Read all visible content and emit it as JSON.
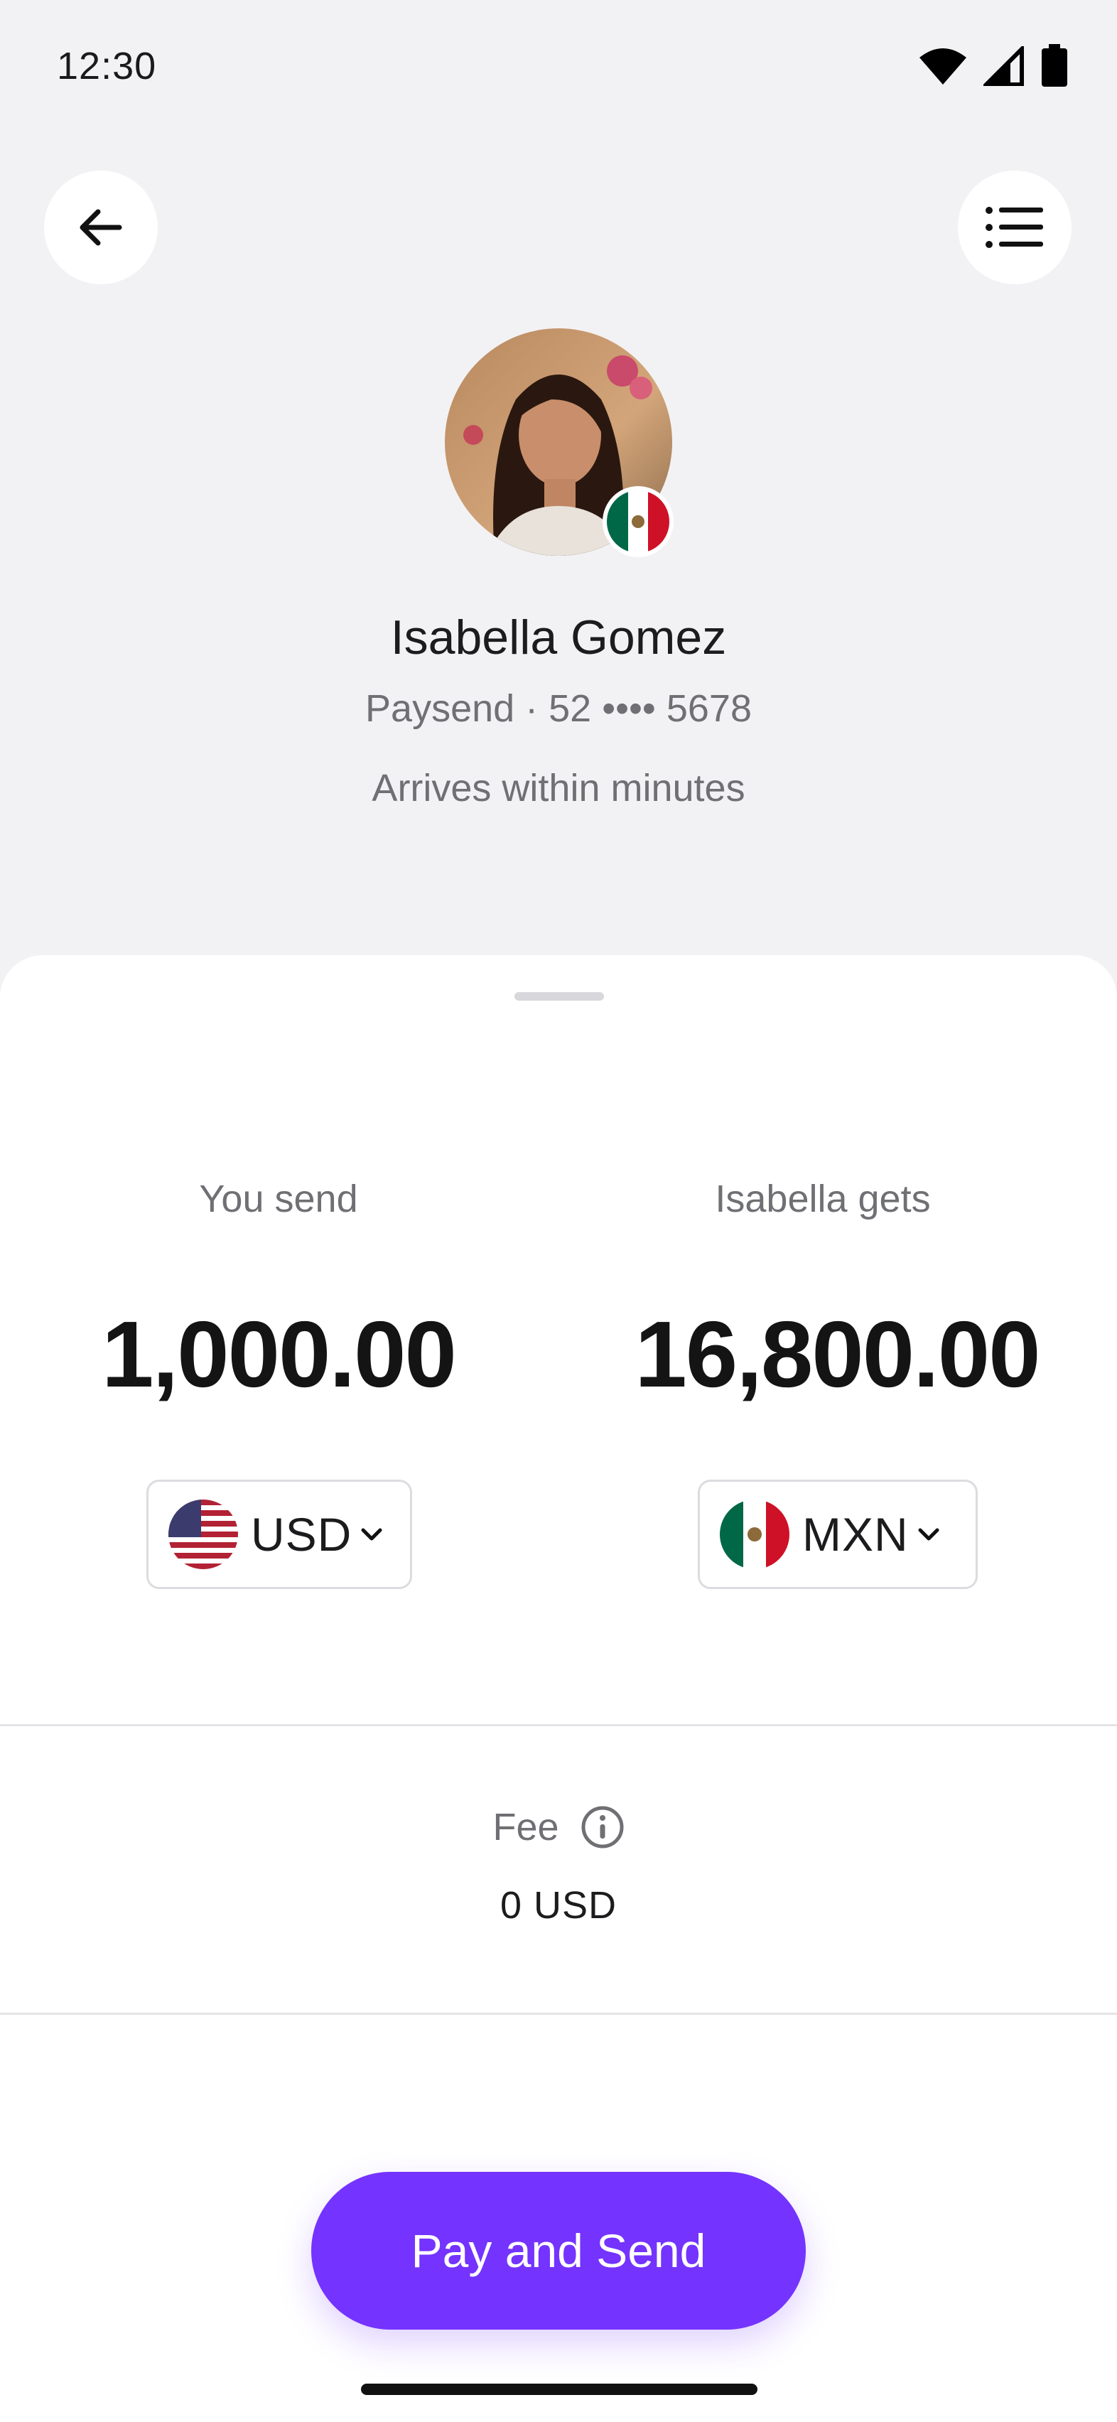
{
  "status_bar": {
    "time": "12:30"
  },
  "header": {
    "back_icon": "arrow-left-icon",
    "menu_icon": "list-icon"
  },
  "contact": {
    "name": "Isabella Gomez",
    "subtitle": "Paysend · 52 •••• 5678",
    "eta": "Arrives within minutes",
    "country_flag": "mexico-flag-icon"
  },
  "transfer": {
    "send_label": "You send",
    "send_amount": "1,000.00",
    "send_currency": "USD",
    "receive_label": "Isabella gets",
    "receive_amount": "16,800.00",
    "receive_currency": "MXN"
  },
  "fee": {
    "label": "Fee",
    "value": "0 USD"
  },
  "cta": {
    "label": "Pay and Send"
  },
  "colors": {
    "accent": "#7433ff",
    "background": "#f2f2f4",
    "sheet": "#ffffff"
  }
}
